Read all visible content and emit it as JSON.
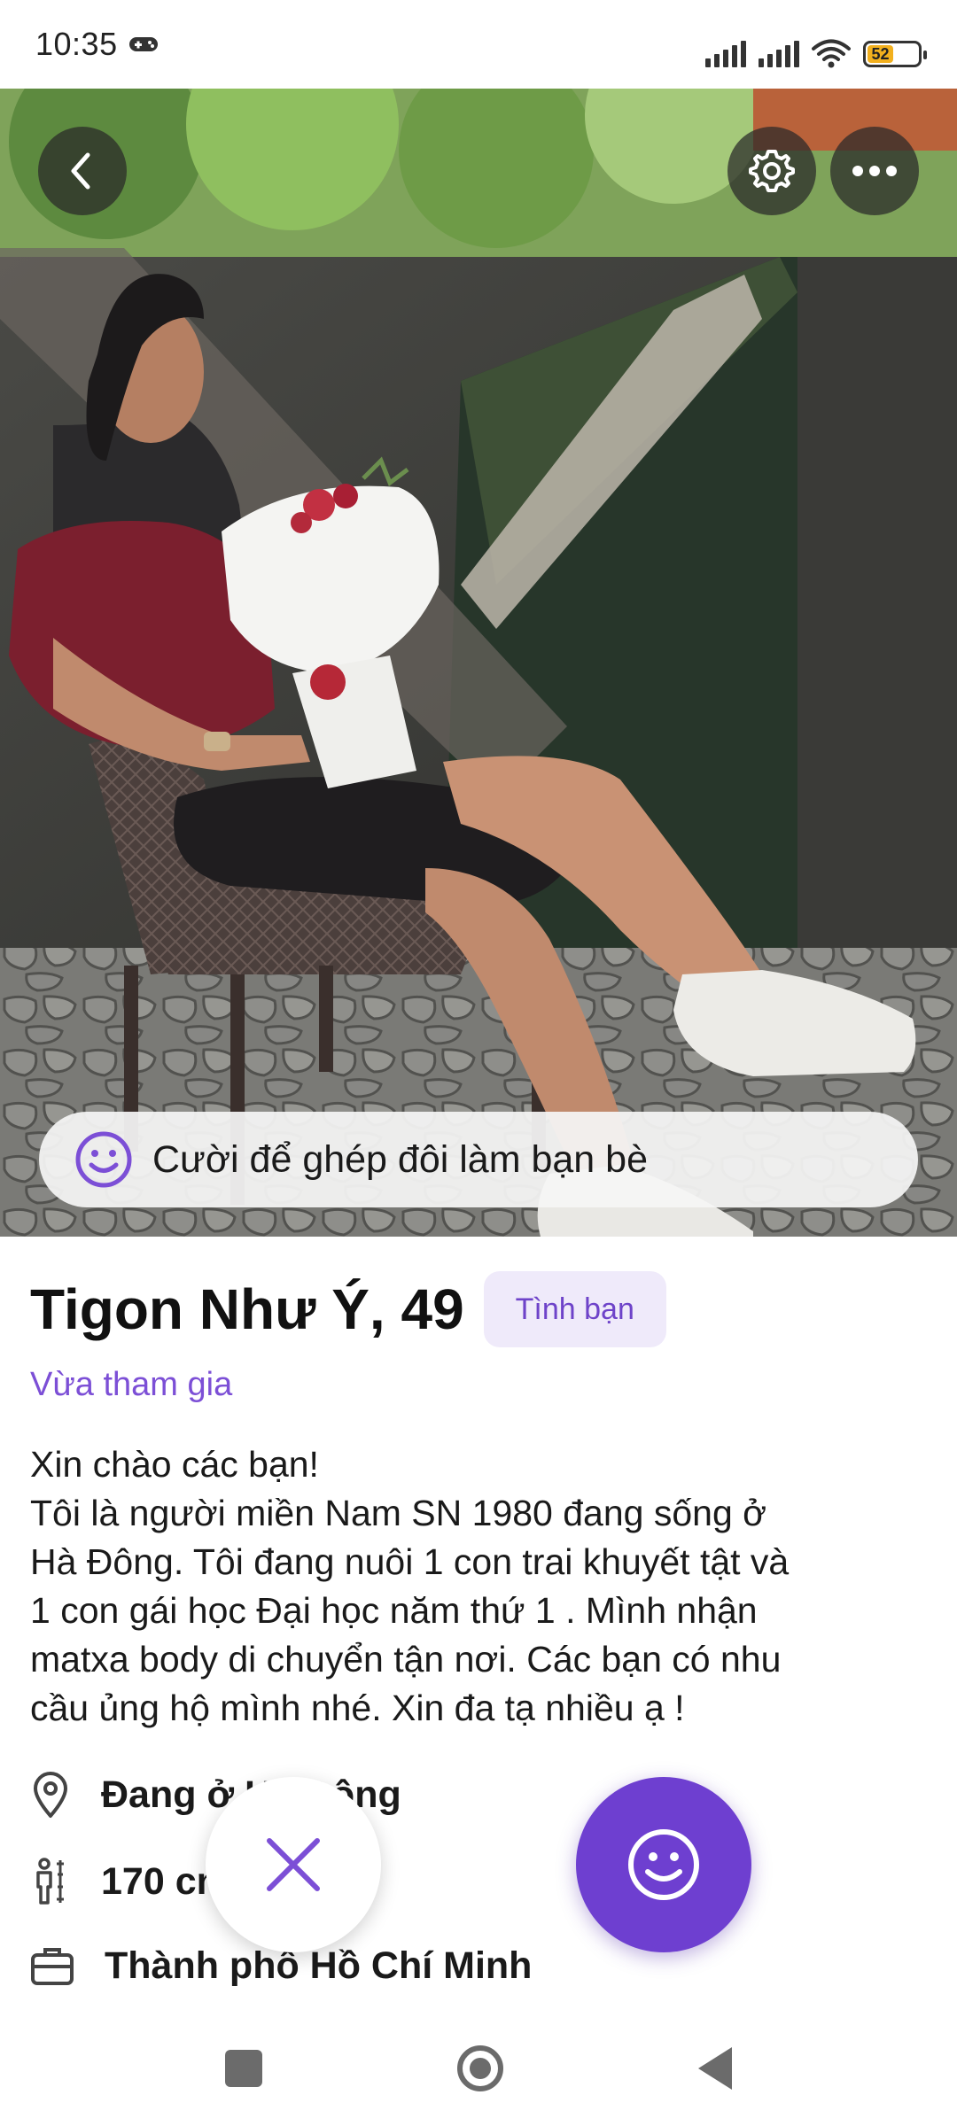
{
  "status_bar": {
    "time": "10:35",
    "battery": "52",
    "icons": [
      "gamepad-icon",
      "signal-icon",
      "signal-icon",
      "wifi-icon",
      "battery-icon"
    ]
  },
  "top_actions": {
    "back_icon": "chevron-left-icon",
    "settings_icon": "gear-icon",
    "more_icon": "more-horizontal-icon"
  },
  "banner": {
    "icon": "smile-icon",
    "text": "Cười để ghép đôi làm bạn bè"
  },
  "profile": {
    "name_age": "Tigon Như Ý, 49",
    "tag": "Tình bạn",
    "joined": "Vừa tham gia",
    "bio_lines": [
      "Xin chào các bạn!",
      "Tôi là người miền Nam SN 1980 đang sống ở",
      "Hà Đông. Tôi đang nuôi 1 con trai khuyết tật và",
      "1 con gái học Đại học năm thứ 1 . Mình nhận",
      "matxa body di chuyển tận nơi. Các bạn có nhu",
      "cầu ủng hộ mình nhé. Xin đa tạ nhiều ạ !"
    ],
    "location": "Đang ở Hà Đông",
    "height": "170 cm",
    "job": "Thành phố Hồ Chí Minh"
  },
  "actions": {
    "dislike_icon": "close-icon",
    "like_icon": "smile-icon"
  },
  "nav": {
    "icons": [
      "recent-apps-icon",
      "home-icon",
      "back-icon"
    ]
  },
  "colors": {
    "accent": "#6e3fd0",
    "tag_bg": "#efeafa",
    "joined_text": "#7c4fd6"
  }
}
